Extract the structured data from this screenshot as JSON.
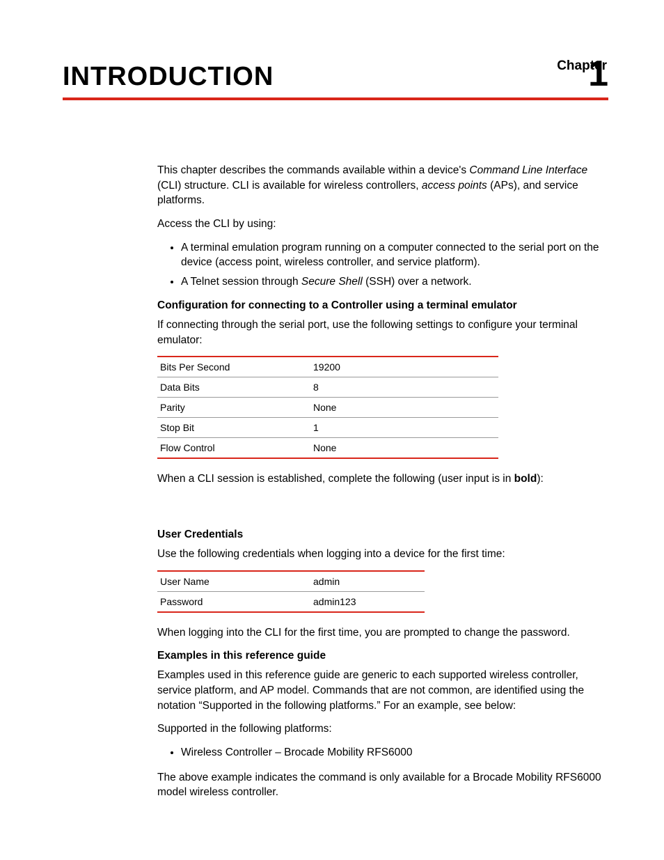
{
  "chapter": {
    "label": "Chapter",
    "number": "1",
    "title": "INTRODUCTION"
  },
  "intro": {
    "p1a": "This chapter describes the commands available within a device's ",
    "p1b": "Command Line Interface",
    "p1c": " (CLI) structure. CLI is available for wireless controllers, ",
    "p1d": "access points",
    "p1e": " (APs), and service platforms.",
    "p2": "Access the CLI by using:",
    "b1": "A terminal emulation program running on a computer connected to the serial port on the device (access point, wireless controller, and service platform).",
    "b2a": "A Telnet session through ",
    "b2b": "Secure Shell",
    "b2c": " (SSH) over a network."
  },
  "config": {
    "head": "Configuration for connecting to a Controller using a terminal emulator",
    "p1": "If connecting through the serial port, use the following settings to configure your terminal emulator:",
    "rows": [
      {
        "k": "Bits Per Second",
        "v": "19200"
      },
      {
        "k": "Data Bits",
        "v": "8"
      },
      {
        "k": "Parity",
        "v": "None"
      },
      {
        "k": "Stop Bit",
        "v": "1"
      },
      {
        "k": "Flow Control",
        "v": "None"
      }
    ],
    "p2a": "When a CLI session is established, complete the following (user input is in ",
    "p2b": "bold",
    "p2c": "):"
  },
  "creds": {
    "head": "User Credentials",
    "p1": "Use the following credentials when logging into a device for the first time:",
    "rows": [
      {
        "k": "User Name",
        "v": "admin"
      },
      {
        "k": "Password",
        "v": "admin123"
      }
    ],
    "p2": "When logging into the CLI for the first time, you are prompted to change the password."
  },
  "examples": {
    "head": "Examples in this reference guide",
    "p1": "Examples used in this reference guide are generic to each supported wireless controller, service platform, and AP model. Commands that are not common, are identified using the notation “Supported in the following platforms.” For an example, see below:",
    "p2": "Supported in the following platforms:",
    "b1": "Wireless Controller – Brocade Mobility RFS6000",
    "p3": "The above example indicates the command is only available for a Brocade Mobility RFS6000 model wireless controller."
  }
}
